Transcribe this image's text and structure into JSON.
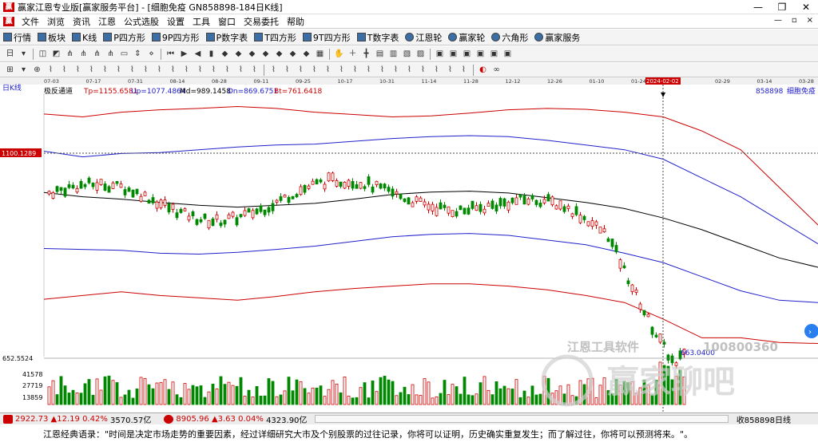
{
  "window": {
    "title": "赢家江恩专业版[赢家服务平台] - [细胞免疫  GN858898-184日K线]",
    "logo": "赢",
    "min": "—",
    "max": "❐",
    "close": "✕"
  },
  "menu": {
    "logo": "赢",
    "items": [
      "文件",
      "浏览",
      "资讯",
      "江恩",
      "公式选股",
      "设置",
      "工具",
      "窗口",
      "交易委托",
      "帮助"
    ],
    "right": [
      "—",
      "▫",
      "×"
    ]
  },
  "toolbar1": {
    "items": [
      "行情",
      "板块",
      "K线",
      "P四方形",
      "9P四方形",
      "P数字表",
      "T四方形",
      "9T四方形",
      "T数字表",
      "江恩轮",
      "赢家轮",
      "六角形",
      "赢家服务"
    ]
  },
  "chart": {
    "period_label": "日K线",
    "indicator": "极反通道",
    "tp": "Tp=1155.6581",
    "up": "Up=1077.4864",
    "md": "Md=989.1458",
    "dn": "Dn=869.6751",
    "bt": "Bt=761.6418",
    "code_label": "858898",
    "name_label": "细胞免疫",
    "price_line_label": "1100.1289",
    "low_label": "652.5524",
    "min_mark": "663.0400",
    "vol_ticks": [
      "41578",
      "27719",
      "13859"
    ],
    "dates": [
      "07-03",
      "07-17",
      "07-31",
      "08-14",
      "08-28",
      "09-11",
      "09-25",
      "10-17",
      "10-31",
      "11-14",
      "11-28",
      "12-12",
      "12-26",
      "01-10",
      "01-24",
      "2024-02-02",
      "02-29",
      "03-14",
      "03-28"
    ],
    "watermark_tools": "江恩工具软件",
    "watermark_phone": "100800360",
    "watermark_big": "赢家聊吧"
  },
  "chart_data": {
    "type": "line",
    "title": "",
    "series": [
      {
        "name": "Tp",
        "values": [
          1156,
          1150,
          1160,
          1165,
          1168,
          1172,
          1168,
          1160,
          1155,
          1150,
          1152,
          1158,
          1165,
          1168,
          1166,
          1160,
          1150,
          1120,
          1080,
          1000,
          920
        ]
      },
      {
        "name": "Up",
        "values": [
          1077,
          1065,
          1072,
          1074,
          1080,
          1086,
          1090,
          1092,
          1098,
          1104,
          1108,
          1110,
          1108,
          1100,
          1090,
          1080,
          1060,
          1020,
          980,
          930,
          880
        ]
      },
      {
        "name": "Md",
        "values": [
          989,
          980,
          975,
          968,
          962,
          958,
          962,
          966,
          975,
          985,
          990,
          992,
          988,
          978,
          968,
          955,
          935,
          910,
          880,
          850,
          830
        ]
      },
      {
        "name": "Dn",
        "values": [
          870,
          868,
          866,
          860,
          858,
          862,
          868,
          875,
          885,
          895,
          900,
          902,
          898,
          888,
          878,
          860,
          840,
          810,
          780,
          760,
          755
        ]
      },
      {
        "name": "Bt",
        "values": [
          762,
          770,
          778,
          770,
          765,
          760,
          768,
          778,
          785,
          790,
          795,
          795,
          790,
          782,
          770,
          755,
          720,
          680,
          680,
          670,
          668
        ]
      }
    ],
    "ylim": [
      640,
      1200
    ]
  },
  "status": {
    "idx1_value": "2922.73",
    "idx1_change": "▲12.19",
    "idx1_pct": "0.42%",
    "idx1_amount": "3570.57亿",
    "idx2_value": "8905.96",
    "idx2_change": "▲3.63",
    "idx2_pct": "0.04%",
    "idx2_amount": "4323.90亿",
    "right_text": "收858898日线"
  },
  "ticker": {
    "text": "江恩经典语录：\"时间是决定市场走势的重要因素，经过详细研究大市及个别股票的过往记录，你将可以证明，历史确实重复发生；而了解过往，你将可以预测将来。\"。"
  },
  "colors": {
    "tp": "#cc0000",
    "up": "#2020cc",
    "md": "#000000",
    "up_candle": "#cc0000",
    "down_candle": "#008800"
  }
}
